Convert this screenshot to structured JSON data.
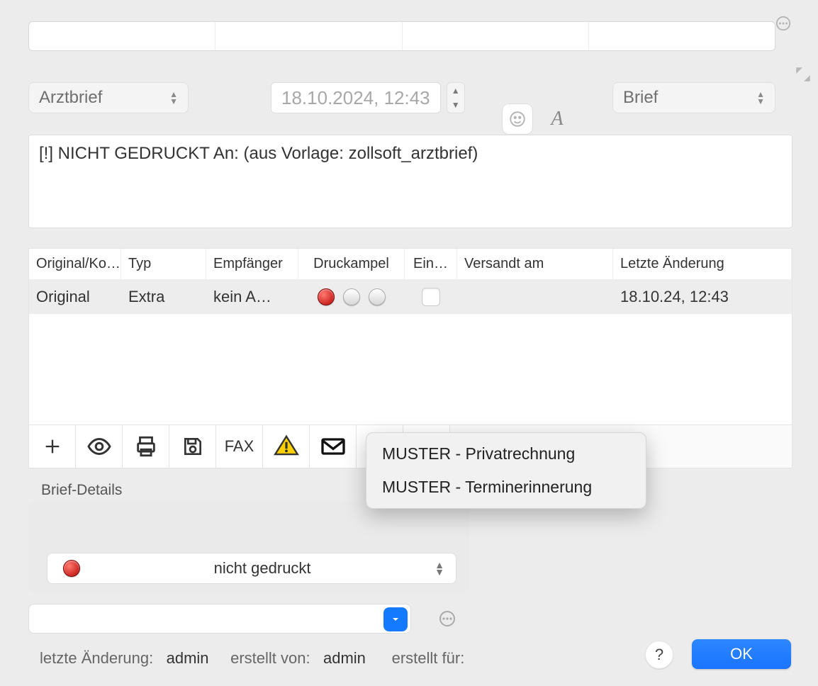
{
  "header": {
    "type_select": "Arztbrief",
    "datetime": "18.10.2024, 12:43",
    "format_select": "Brief"
  },
  "subject": "[!] NICHT GEDRUCKT An:   (aus Vorlage: zollsoft_arztbrief)",
  "table": {
    "columns": {
      "original_kopie": "Original/Ko…",
      "typ": "Typ",
      "empfaenger": "Empfänger",
      "druckampel": "Druckampel",
      "ein": "Ein…",
      "versandt_am": "Versandt am",
      "letzte_aenderung": "Letzte Änderung"
    },
    "row0": {
      "original_kopie": "Original",
      "typ": "Extra",
      "empfaenger": "kein A…",
      "versandt_am": "",
      "letzte_aenderung": "18.10.24, 12:43"
    }
  },
  "toolbar": {
    "fax": "FAX"
  },
  "dropdown": {
    "item0": "MUSTER - Privatrechnung",
    "item1": "MUSTER - Terminerinnerung"
  },
  "details": {
    "label": "Brief-Details",
    "status": "nicht gedruckt"
  },
  "footer": {
    "letzte_aenderung_label": "letzte Änderung:",
    "letzte_aenderung_value": "admin",
    "erstellt_von_label": "erstellt von:",
    "erstellt_von_value": "admin",
    "erstellt_fuer_label": "erstellt für:",
    "help": "?",
    "ok": "OK"
  }
}
